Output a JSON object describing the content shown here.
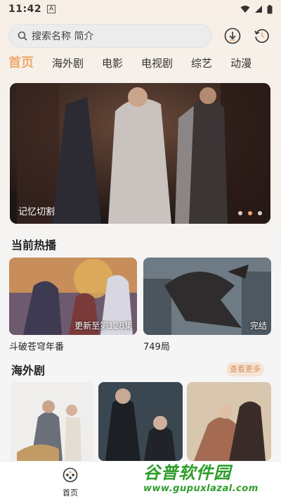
{
  "status_bar": {
    "time": "11:42",
    "app_badge": "A"
  },
  "search": {
    "placeholder": "搜索名称 简介"
  },
  "header_icons": [
    "download-icon",
    "history-icon"
  ],
  "tabs": [
    {
      "label": "首页",
      "active": true
    },
    {
      "label": "海外剧",
      "active": false
    },
    {
      "label": "电影",
      "active": false
    },
    {
      "label": "电视剧",
      "active": false
    },
    {
      "label": "综艺",
      "active": false
    },
    {
      "label": "动漫",
      "active": false
    }
  ],
  "banner": {
    "title": "记忆切割",
    "dots": 3,
    "active_dot": 2
  },
  "section_hot": {
    "title": "当前热播"
  },
  "hot_items": [
    {
      "title": "斗破苍穹年番",
      "tag": "更新至第128集"
    },
    {
      "title": "749局",
      "tag": "完结"
    }
  ],
  "section_overseas": {
    "title": "海外剧",
    "more_label": "查看更多"
  },
  "nav": {
    "home_label": "首页"
  },
  "watermark": {
    "main": "谷普软件园",
    "url": "www.gupuxlazal.com"
  },
  "colors": {
    "accent": "#f0a86b",
    "more_bg": "#f4e4d6",
    "watermark": "#2f9d2b"
  }
}
